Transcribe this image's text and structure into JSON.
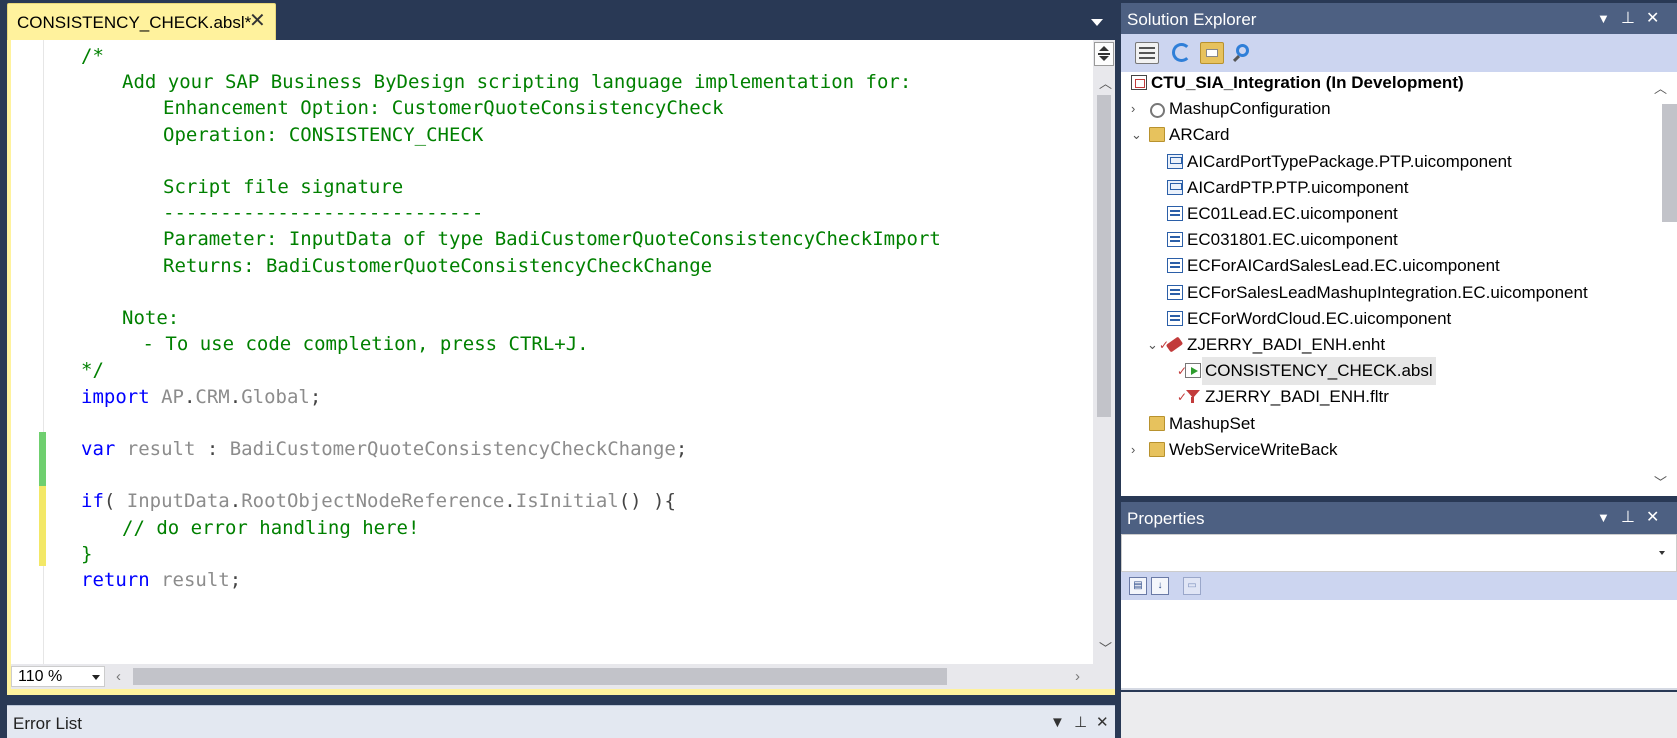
{
  "editor": {
    "tab_title": "CONSISTENCY_CHECK.absl*",
    "tab_close_glyph": "✕",
    "zoom": "110 %",
    "code_lines": [
      {
        "text": "/*",
        "indent": 0,
        "style": "green"
      },
      {
        "text": "Add your SAP Business ByDesign scripting language implementation for:",
        "indent": 1,
        "style": "green"
      },
      {
        "text": "Enhancement Option: CustomerQuoteConsistencyCheck",
        "indent": 2,
        "style": "green"
      },
      {
        "text": "Operation: CONSISTENCY_CHECK",
        "indent": 2,
        "style": "green"
      },
      {
        "text": "",
        "indent": 0,
        "style": "green"
      },
      {
        "text": "Script file signature",
        "indent": 2,
        "style": "green"
      },
      {
        "text": "----------------------------",
        "indent": 2,
        "style": "green"
      },
      {
        "text": "Parameter: InputData of type BadiCustomerQuoteConsistencyCheckImport",
        "indent": 2,
        "style": "green"
      },
      {
        "text": "Returns: BadiCustomerQuoteConsistencyCheckChange",
        "indent": 2,
        "style": "green"
      },
      {
        "text": "",
        "indent": 0,
        "style": "green"
      },
      {
        "text": "Note:",
        "indent": 1,
        "style": "green"
      },
      {
        "text": "- To use code completion, press CTRL+J.",
        "indent": 1.5,
        "style": "green"
      },
      {
        "text": "*/",
        "indent": 0,
        "style": "green"
      },
      {
        "tokens": [
          [
            "import",
            "kw"
          ],
          [
            " AP",
            "gray"
          ],
          [
            ".",
            "dark"
          ],
          [
            "CRM",
            "gray"
          ],
          [
            ".",
            "dark"
          ],
          [
            "Global",
            "gray"
          ],
          [
            ";",
            "dark"
          ]
        ],
        "indent": 0
      },
      {
        "text": "",
        "indent": 0,
        "style": "green"
      },
      {
        "tokens": [
          [
            "var",
            "kw"
          ],
          [
            " result ",
            "gray"
          ],
          [
            ": ",
            "dark"
          ],
          [
            "BadiCustomerQuoteConsistencyCheckChange",
            "gray"
          ],
          [
            ";",
            "dark"
          ]
        ],
        "indent": 0
      },
      {
        "text": "",
        "indent": 0,
        "style": "green"
      },
      {
        "tokens": [
          [
            "if",
            "kw"
          ],
          [
            "( ",
            "dark"
          ],
          [
            "InputData",
            "gray"
          ],
          [
            ".",
            "dark"
          ],
          [
            "RootObjectNodeReference",
            "gray"
          ],
          [
            ".",
            "dark"
          ],
          [
            "IsInitial",
            "gray"
          ],
          [
            "() ){",
            "dark"
          ]
        ],
        "indent": 0
      },
      {
        "text": "// do error handling here!",
        "indent": 1,
        "style": "green"
      },
      {
        "text": "}",
        "indent": 0,
        "style": "green"
      },
      {
        "tokens": [
          [
            "return",
            "kw"
          ],
          [
            " result",
            "gray"
          ],
          [
            ";",
            "dark"
          ]
        ],
        "indent": 0
      }
    ]
  },
  "solution_explorer": {
    "title": "Solution Explorer",
    "header_buttons": [
      "▼",
      "⊥",
      "✕"
    ],
    "toolbar_icons": [
      "properties-icon",
      "refresh-icon",
      "show-all-files-icon",
      "find-icon"
    ],
    "items": [
      {
        "label": "CTU_SIA_Integration (In Development)",
        "level": 0,
        "icon": "proj",
        "root": true
      },
      {
        "label": "MashupConfiguration",
        "level": 1,
        "icon": "mash",
        "expander": "›"
      },
      {
        "label": "ARCard",
        "level": 1,
        "icon": "folder",
        "expander": "⌄"
      },
      {
        "label": "AICardPortTypePackage.PTP.uicomponent",
        "level": 2,
        "icon": "ptp"
      },
      {
        "label": "AICardPTP.PTP.uicomponent",
        "level": 2,
        "icon": "ptp"
      },
      {
        "label": "EC01Lead.EC.uicomponent",
        "level": 2,
        "icon": "comp"
      },
      {
        "label": "EC031801.EC.uicomponent",
        "level": 2,
        "icon": "comp"
      },
      {
        "label": "ECForAICardSalesLead.EC.uicomponent",
        "level": 2,
        "icon": "comp"
      },
      {
        "label": "ECForSalesLeadMashupIntegration.EC.uicomponent",
        "level": 2,
        "icon": "comp"
      },
      {
        "label": "ECForWordCloud.EC.uicomponent",
        "level": 2,
        "icon": "comp"
      },
      {
        "label": "ZJERRY_BADI_ENH.enht",
        "level": 2,
        "icon": "enh",
        "expander": "⌄",
        "check": true
      },
      {
        "label": "CONSISTENCY_CHECK.absl",
        "level": 3,
        "icon": "absl",
        "check": true,
        "selected": true
      },
      {
        "label": "ZJERRY_BADI_ENH.fltr",
        "level": 3,
        "icon": "fltr",
        "check": true
      },
      {
        "label": "MashupSet",
        "level": 1,
        "icon": "folder"
      },
      {
        "label": "WebServiceWriteBack",
        "level": 1,
        "icon": "folder",
        "expander": "›"
      }
    ]
  },
  "properties": {
    "title": "Properties",
    "header_buttons": [
      "▼",
      "⊥",
      "✕"
    ]
  },
  "error_list": {
    "title": "Error List",
    "header_buttons": [
      "▼",
      "⊥",
      "✕"
    ]
  },
  "colors": {
    "chrome": "#293955",
    "tab_active": "#fff29d",
    "panel_header": "#4d6082",
    "change_green": "#6fcf6f",
    "change_yellow": "#f3e867"
  }
}
